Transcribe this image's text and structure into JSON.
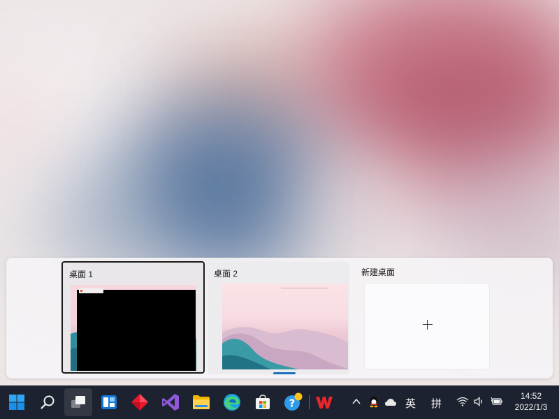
{
  "desktops": [
    {
      "title": "桌面 1",
      "selected": true
    },
    {
      "title": "桌面 2",
      "selected": false
    }
  ],
  "new_desktop": {
    "label": "新建桌面"
  },
  "taskbar": {
    "apps": [
      {
        "name": "Start",
        "icon": "windows-logo-icon"
      },
      {
        "name": "Search",
        "icon": "search-icon"
      },
      {
        "name": "Task View",
        "icon": "task-view-icon"
      },
      {
        "name": "Widgets",
        "icon": "widgets-icon"
      },
      {
        "name": "App",
        "icon": "red-diamond-app-icon"
      },
      {
        "name": "Visual Studio",
        "icon": "visual-studio-icon"
      },
      {
        "name": "File Explorer",
        "icon": "folder-icon"
      },
      {
        "name": "Microsoft Edge",
        "icon": "edge-browser-icon"
      },
      {
        "name": "Microsoft Store",
        "icon": "store-icon"
      },
      {
        "name": "Get Help",
        "icon": "help-icon"
      },
      {
        "name": "WPS Office",
        "icon": "wps-icon"
      }
    ],
    "tray": {
      "ime_lang": "英",
      "ime_mode": "拼",
      "time": "14:52",
      "date": "2022/1/3"
    }
  },
  "colors": {
    "taskbar": "#1d2230",
    "accent": "#1c6fc0",
    "panel": "#f5f3f5"
  }
}
